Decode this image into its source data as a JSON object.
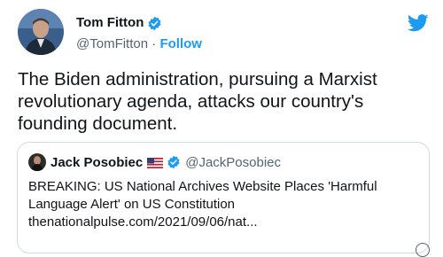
{
  "author": {
    "name": "Tom Fitton",
    "handle": "@TomFitton",
    "separator": " · ",
    "follow_label": "Follow"
  },
  "tweet": {
    "text": "The Biden administration, pursuing a Marxist revolutionary agenda, attacks our country's founding document."
  },
  "quoted": {
    "name": "Jack Posobiec",
    "handle": "@JackPosobiec",
    "lines": [
      "BREAKING: US National Archives Website Places 'Harmful",
      "Language Alert' on US Constitution",
      "thenationalpulse.com/2021/09/06/nat..."
    ]
  },
  "icons": {
    "verified": "verified-badge-icon",
    "twitter": "twitter-bird-icon",
    "flag": "us-flag-icon",
    "info": "info-icon"
  },
  "colors": {
    "accent": "#1d9bf0",
    "text": "#0f1419",
    "muted": "#536471",
    "border": "#cfd9de"
  }
}
